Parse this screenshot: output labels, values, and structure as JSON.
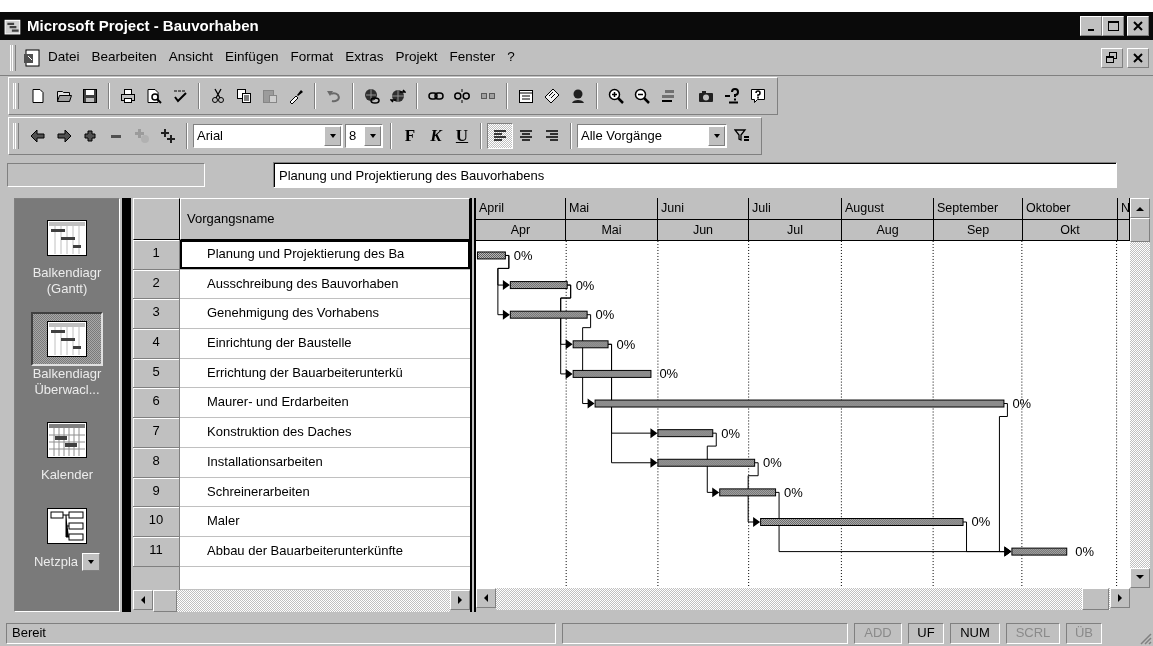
{
  "window": {
    "title": "Microsoft Project - Bauvorhaben"
  },
  "menu": [
    {
      "label": "Datei"
    },
    {
      "label": "Bearbeiten"
    },
    {
      "label": "Ansicht"
    },
    {
      "label": "Einfügen"
    },
    {
      "label": "Format"
    },
    {
      "label": "Extras"
    },
    {
      "label": "Projekt"
    },
    {
      "label": "Fenster"
    },
    {
      "label": "?"
    }
  ],
  "toolbar_standard": [
    [
      {
        "disabled": false
      },
      {
        "disabled": false
      },
      {
        "disabled": false
      }
    ],
    [
      {
        "disabled": false
      },
      {
        "disabled": false
      },
      {
        "disabled": false
      }
    ],
    [
      {
        "disabled": false
      },
      {
        "disabled": false
      },
      {
        "disabled": true
      },
      {
        "disabled": false
      }
    ],
    [
      {
        "disabled": true
      }
    ],
    [
      {
        "disabled": false
      },
      {
        "disabled": false
      }
    ],
    [
      {
        "disabled": false
      },
      {
        "disabled": false
      },
      {
        "disabled": false
      }
    ],
    [
      {
        "disabled": false
      },
      {
        "disabled": false
      },
      {
        "disabled": false
      }
    ],
    [
      {
        "disabled": false
      },
      {
        "disabled": false
      },
      {
        "disabled": false
      }
    ],
    [
      {
        "disabled": false
      },
      {
        "disabled": false
      },
      {
        "disabled": false
      }
    ]
  ],
  "toolbar_formatting": [
    [
      {
        "kind": "icon",
        "disabled": false
      },
      {
        "kind": "icon",
        "disabled": false
      },
      {
        "kind": "icon",
        "disabled": false
      },
      {
        "kind": "icon",
        "disabled": false
      },
      {
        "kind": "icon",
        "disabled": true
      },
      {
        "kind": "icon",
        "disabled": false
      }
    ],
    [
      {
        "kind": "combo",
        "value": "Arial"
      },
      {
        "kind": "combo",
        "value": "8"
      }
    ],
    [
      {
        "kind": "text",
        "label": "F",
        "selected": false
      },
      {
        "kind": "text",
        "label": "K",
        "selected": false
      },
      {
        "kind": "text",
        "label": "U",
        "selected": false
      }
    ],
    [
      {
        "kind": "icon",
        "selected": true
      },
      {
        "kind": "icon",
        "selected": false
      },
      {
        "kind": "icon",
        "selected": false
      }
    ],
    [
      {
        "kind": "combo",
        "value": "Alle Vorgänge"
      },
      {
        "kind": "icon",
        "disabled": false
      }
    ]
  ],
  "entry_bar": {
    "value": "Planung und Projektierung des Bauvorhabens"
  },
  "view_bar": [
    {
      "label": "Balkendiagr (Gantt)",
      "selected": false
    },
    {
      "label": "Balkendiagr Überwacl...",
      "selected": true
    },
    {
      "label": "Kalender",
      "selected": false
    },
    {
      "label": "Netzpla",
      "selected": false
    }
  ],
  "table": {
    "columns": [
      "Vorgangsname"
    ]
  },
  "tasks": [
    {
      "id": "1",
      "name": "Planung und Projektierung des Ba",
      "progress": "0%",
      "selected": true
    },
    {
      "id": "2",
      "name": "Ausschreibung des Bauvorhaben",
      "progress": "0%",
      "selected": false
    },
    {
      "id": "3",
      "name": "Genehmigung des Vorhabens",
      "progress": "0%",
      "selected": false
    },
    {
      "id": "4",
      "name": "Einrichtung der Baustelle",
      "progress": "0%",
      "selected": false
    },
    {
      "id": "5",
      "name": "Errichtung der Bauarbeiterunterkü",
      "progress": "0%",
      "selected": false
    },
    {
      "id": "6",
      "name": "Maurer- und Erdarbeiten",
      "progress": "0%",
      "selected": false
    },
    {
      "id": "7",
      "name": "Konstruktion des Daches",
      "progress": "0%",
      "selected": false
    },
    {
      "id": "8",
      "name": "Installationsarbeiten",
      "progress": "0%",
      "selected": false
    },
    {
      "id": "9",
      "name": "Schreinerarbeiten",
      "progress": "0%",
      "selected": false
    },
    {
      "id": "10",
      "name": "Maler",
      "progress": "0%",
      "selected": false
    },
    {
      "id": "11",
      "name": "Abbau der Bauarbeiterunterkünfte",
      "progress": "0%",
      "selected": false
    }
  ],
  "timescale": {
    "major": [
      "April",
      "Mai",
      "Juni",
      "Juli",
      "August",
      "September",
      "Oktober",
      "N"
    ],
    "minor": [
      "Apr",
      "Mai",
      "Jun",
      "Jul",
      "Aug",
      "Sep",
      "Okt"
    ]
  },
  "status_bar": {
    "message": "Bereit",
    "indicators": [
      {
        "label": "ADD",
        "on": false
      },
      {
        "label": "UF",
        "on": true
      },
      {
        "label": "NUM",
        "on": true
      },
      {
        "label": "SCRL",
        "on": false
      },
      {
        "label": "ÜB",
        "on": false
      }
    ]
  }
}
